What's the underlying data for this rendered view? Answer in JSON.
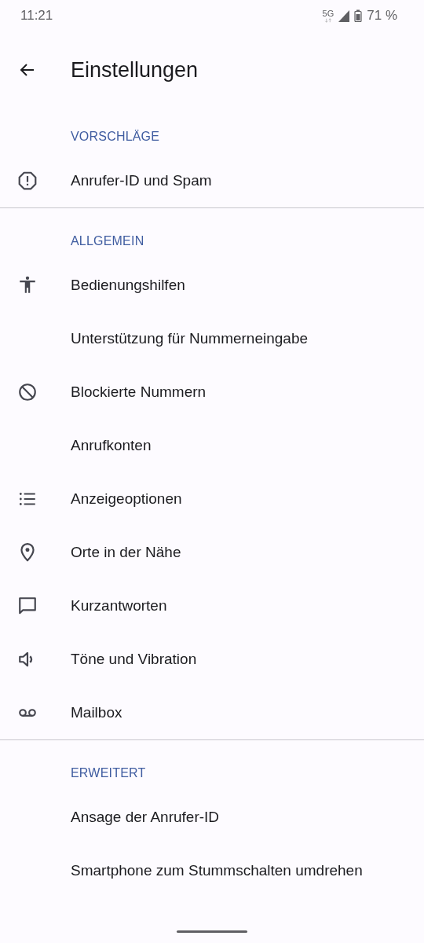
{
  "status_bar": {
    "time": "11:21",
    "network": "5G",
    "battery": "71 %"
  },
  "header": {
    "title": "Einstellungen"
  },
  "sections": [
    {
      "title": "VORSCHLÄGE",
      "items": [
        {
          "label": "Anrufer-ID und Spam",
          "kind": "alert"
        }
      ]
    },
    {
      "title": "ALLGEMEIN",
      "items": [
        {
          "label": "Bedienungshilfen",
          "kind": "accessibility"
        },
        {
          "label": "Unterstützung für Nummerneingabe",
          "kind": "plain"
        },
        {
          "label": "Blockierte Nummern",
          "kind": "block"
        },
        {
          "label": "Anrufkonten",
          "kind": "plain"
        },
        {
          "label": "Anzeigeoptionen",
          "kind": "list"
        },
        {
          "label": "Orte in der Nähe",
          "kind": "pin"
        },
        {
          "label": "Kurzantworten",
          "kind": "chat"
        },
        {
          "label": "Töne und Vibration",
          "kind": "volume"
        },
        {
          "label": "Mailbox",
          "kind": "voicemail"
        }
      ]
    },
    {
      "title": "ERWEITERT",
      "items": [
        {
          "label": "Ansage der Anrufer-ID",
          "kind": "plain"
        },
        {
          "label": "Smartphone zum Stummschalten umdrehen",
          "kind": "plain"
        }
      ]
    }
  ]
}
